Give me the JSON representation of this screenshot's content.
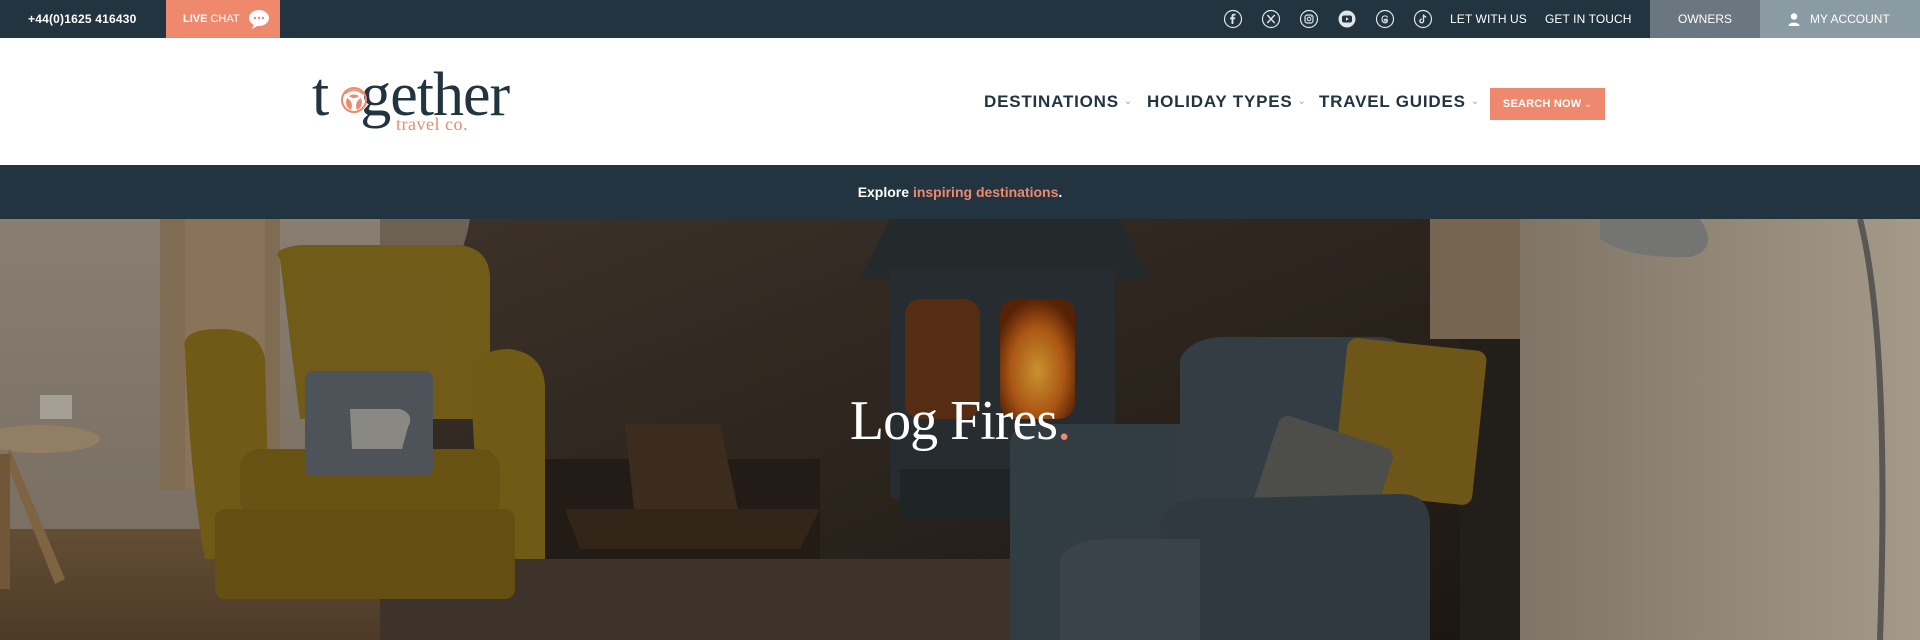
{
  "topbar": {
    "phone": "+44(0)1625 416430",
    "live_chat_bold": "LIVE",
    "live_chat_rest": "CHAT",
    "social_icons": [
      "facebook-icon",
      "x-icon",
      "instagram-icon",
      "youtube-icon",
      "threads-icon",
      "tiktok-icon"
    ],
    "links": [
      "LET WITH US",
      "GET IN TOUCH"
    ],
    "owners": "OWNERS",
    "my_account": "MY ACCOUNT"
  },
  "header": {
    "logo_main": "together",
    "logo_sub": "travel co.",
    "nav": [
      {
        "label": "DESTINATIONS"
      },
      {
        "label": "HOLIDAY TYPES"
      },
      {
        "label": "TRAVEL GUIDES"
      }
    ],
    "search_button": "SEARCH NOW"
  },
  "banner": {
    "prefix": "Explore ",
    "accent": "inspiring destinations",
    "suffix": "."
  },
  "hero": {
    "title": "Log Fires",
    "title_dot": "."
  },
  "colors": {
    "navy": "#213440",
    "coral": "#ee896e",
    "owners_bg": "#6a7680",
    "account_bg": "#8a9ba4"
  }
}
